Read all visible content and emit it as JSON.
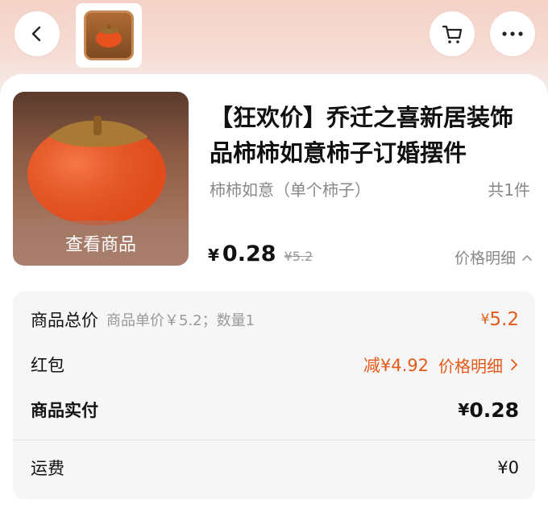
{
  "header": {
    "back_icon": "chevron-left-icon",
    "cart_icon": "cart-icon",
    "more_icon": "more-dots-icon"
  },
  "product": {
    "title": "【狂欢价】乔迁之喜新居装饰品柿柿如意柿子订婚摆件",
    "sku": "柿柿如意（单个柿子）",
    "quantity": "共1件",
    "view_label": "查看商品",
    "price_currency": "¥",
    "price": "0.28",
    "original_price": "¥5.2",
    "price_detail_label": "价格明细"
  },
  "summary": {
    "total_label": "商品总价",
    "total_sub": "商品单价￥5.2；数量1",
    "total_currency": "¥",
    "total_value": "5.2",
    "red_packet_label": "红包",
    "red_packet_value": "减¥4.92",
    "red_packet_link": "价格明细",
    "paid_label": "商品实付",
    "paid_currency": "¥",
    "paid_value": "0.28",
    "shipping_label": "运费",
    "shipping_value": "¥0"
  },
  "colors": {
    "accent": "#e45a1a",
    "persimmon": "#e8501e",
    "header_bg": "#f4d2c7"
  }
}
